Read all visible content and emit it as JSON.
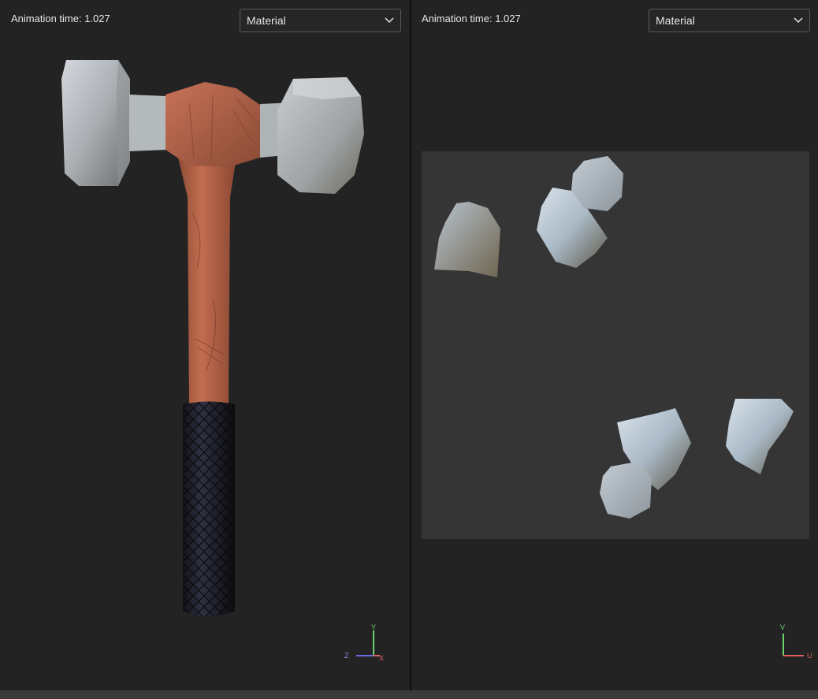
{
  "left_viewport": {
    "animation_label": "Animation time: 1.027",
    "view_mode": "Material",
    "axis_labels": {
      "y": "Y",
      "z": "Z",
      "x": "X"
    }
  },
  "right_viewport": {
    "animation_label": "Animation time: 1.027",
    "view_mode": "Material",
    "axis_labels": {
      "v": "V",
      "u": "U"
    }
  },
  "icons": {
    "dropdown": "chevron-down-icon",
    "axis_gizmo": "axis-gizmo-icon"
  },
  "colors": {
    "background": "#232323",
    "uv_background": "#353535",
    "metal": "#b8bec3",
    "wood": "#b8644a",
    "grip": "#1e1f2a",
    "axis_x": "#e06060",
    "axis_y": "#6fd06f",
    "axis_z": "#6a6ae0"
  }
}
